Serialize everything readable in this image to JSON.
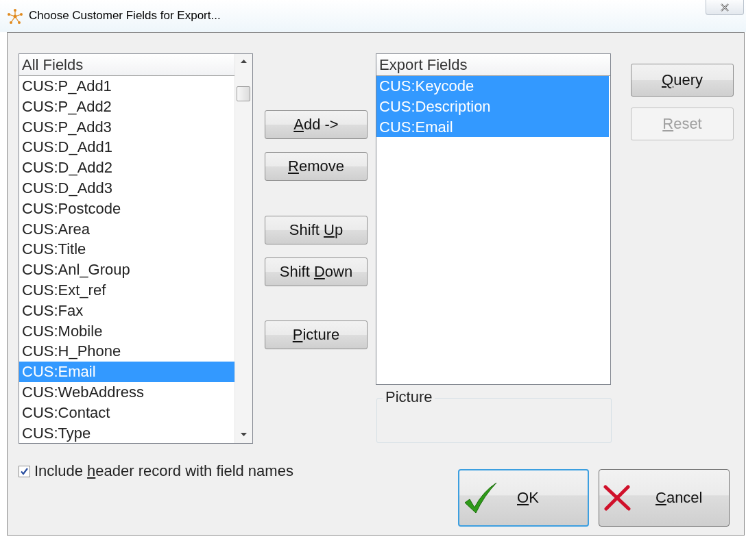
{
  "window": {
    "title": "Choose Customer Fields for Export..."
  },
  "all_fields": {
    "header": "All Fields",
    "items": [
      {
        "label": "CUS:P_Add1",
        "selected": false
      },
      {
        "label": "CUS:P_Add2",
        "selected": false
      },
      {
        "label": "CUS:P_Add3",
        "selected": false
      },
      {
        "label": "CUS:D_Add1",
        "selected": false
      },
      {
        "label": "CUS:D_Add2",
        "selected": false
      },
      {
        "label": "CUS:D_Add3",
        "selected": false
      },
      {
        "label": "CUS:Postcode",
        "selected": false
      },
      {
        "label": "CUS:Area",
        "selected": false
      },
      {
        "label": "CUS:Title",
        "selected": false
      },
      {
        "label": "CUS:Anl_Group",
        "selected": false
      },
      {
        "label": "CUS:Ext_ref",
        "selected": false
      },
      {
        "label": "CUS:Fax",
        "selected": false
      },
      {
        "label": "CUS:Mobile",
        "selected": false
      },
      {
        "label": "CUS:H_Phone",
        "selected": false
      },
      {
        "label": "CUS:Email",
        "selected": true
      },
      {
        "label": "CUS:WebAddress",
        "selected": false
      },
      {
        "label": "CUS:Contact",
        "selected": false
      },
      {
        "label": "CUS:Type",
        "selected": false
      }
    ]
  },
  "middle_buttons": [
    {
      "key": "A",
      "post": "dd ->"
    },
    {
      "key": "R",
      "post": "emove"
    },
    {
      "pre": "Shift ",
      "key": "U",
      "post": "p"
    },
    {
      "pre": "Shift ",
      "key": "D",
      "post": "own"
    },
    {
      "key": "P",
      "post": "icture"
    }
  ],
  "export_fields": {
    "header": "Export Fields",
    "items": [
      {
        "label": "CUS:Keycode",
        "selected": true
      },
      {
        "label": "CUS:Description",
        "selected": true
      },
      {
        "label": "CUS:Email",
        "selected": true
      }
    ]
  },
  "picture_group": {
    "label": "Picture"
  },
  "side_buttons": [
    {
      "key": "Q",
      "post": "uery",
      "disabled": false
    },
    {
      "key": "R",
      "post": "eset",
      "disabled": true
    }
  ],
  "include_header": {
    "pre": "Include ",
    "key": "h",
    "post": "eader record with field names",
    "checked": true
  },
  "dialog_buttons": [
    {
      "kind": "ok",
      "key": "O",
      "post": "K",
      "default": true
    },
    {
      "kind": "cancel",
      "key": "C",
      "post": "ancel",
      "default": false
    }
  ]
}
